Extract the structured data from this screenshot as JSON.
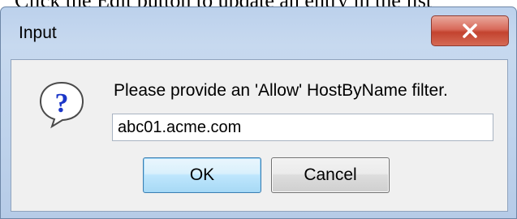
{
  "background_text": "Click the Edit button to update an entry in the list",
  "dialog": {
    "title": "Input",
    "message": "Please provide an 'Allow' HostByName filter.",
    "input_value": "abc01.acme.com",
    "ok_label": "OK",
    "cancel_label": "Cancel",
    "close_glyph": "✕"
  },
  "icons": {
    "close": "close-icon",
    "question": "question-icon"
  },
  "colors": {
    "window_frame": "#bfd3ec",
    "close_button": "#c3432f",
    "ok_button_border": "#3c7fb1",
    "question_icon": "#1b36c8"
  }
}
